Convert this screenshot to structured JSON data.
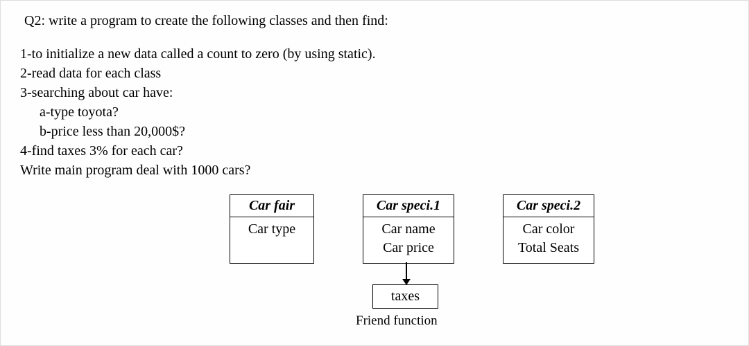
{
  "question": {
    "title": "Q2: write a program to create the following classes and then find:",
    "lines": {
      "l1": "1-to initialize a new data called a count to zero (by using static).",
      "l2": "2-read data for each class",
      "l3": "3-searching  about car have:",
      "l3a": "a-type toyota?",
      "l3b": "b-price less than 20,000$?",
      "l4": "4-find taxes 3%  for each car?",
      "l5": "Write main program deal with 1000 cars?"
    }
  },
  "boxes": {
    "fair": {
      "header": "Car fair",
      "body1": "Car type"
    },
    "spec1": {
      "header": "Car speci.1",
      "body1": "Car name",
      "body2": "Car price"
    },
    "spec2": {
      "header": "Car speci.2",
      "body1": "Car color",
      "body2": "Total Seats"
    }
  },
  "taxes": {
    "label": "taxes",
    "caption": "Friend function"
  }
}
